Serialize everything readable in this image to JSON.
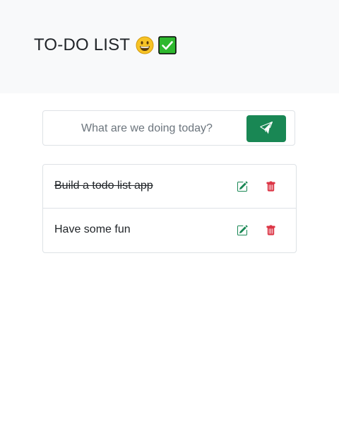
{
  "header": {
    "title": "TO-DO LIST",
    "emojis": [
      "grinning-face",
      "check-mark-button"
    ]
  },
  "form": {
    "input_value": "",
    "placeholder": "What are we doing today?",
    "submit_icon": "paper-plane-icon"
  },
  "todos": [
    {
      "text": "Build a todo list app",
      "completed": true
    },
    {
      "text": "Have some fun",
      "completed": false
    }
  ],
  "colors": {
    "header_bg": "#f8f9fa",
    "success": "#198754",
    "danger": "#dc3545",
    "border": "#dee2e6",
    "text": "#212529",
    "placeholder": "#6c757d"
  }
}
